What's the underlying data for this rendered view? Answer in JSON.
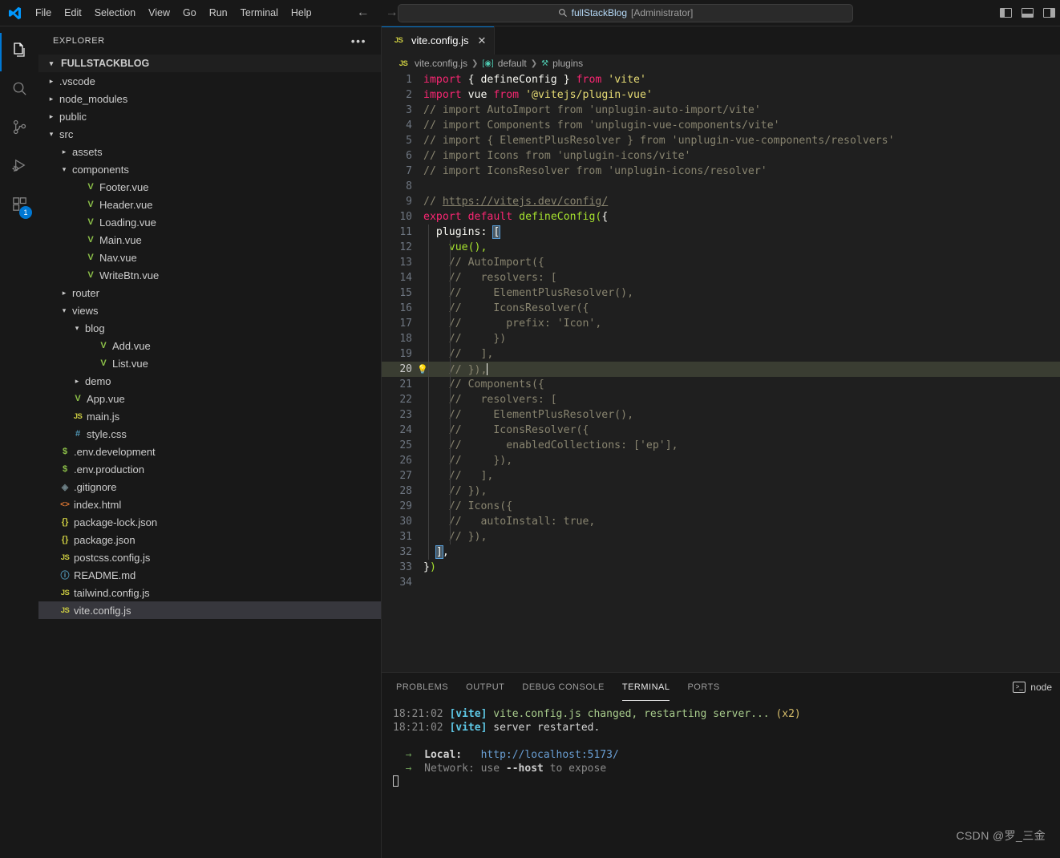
{
  "titlebar": {
    "logo_icon": "vscode-logo-icon",
    "menus": [
      "File",
      "Edit",
      "Selection",
      "View",
      "Go",
      "Run",
      "Terminal",
      "Help"
    ],
    "nav_back_icon": "arrow-left-icon",
    "nav_forward_icon": "arrow-right-icon",
    "search": {
      "icon": "search-icon",
      "project": "fullStackBlog",
      "suffix": "[Administrator]"
    },
    "layout_controls": [
      "toggle-primary-sidebar-icon",
      "toggle-panel-icon",
      "toggle-secondary-sidebar-icon"
    ]
  },
  "activitybar": {
    "items": [
      {
        "name": "explorer",
        "icon": "files-icon",
        "active": true,
        "badge": ""
      },
      {
        "name": "search",
        "icon": "search-icon",
        "active": false,
        "badge": ""
      },
      {
        "name": "source-control",
        "icon": "source-control-icon",
        "active": false,
        "badge": ""
      },
      {
        "name": "run-and-debug",
        "icon": "run-debug-icon",
        "active": false,
        "badge": ""
      },
      {
        "name": "extensions",
        "icon": "extensions-icon",
        "active": false,
        "badge": "1"
      }
    ]
  },
  "sidebar": {
    "title": "EXPLORER",
    "more_actions": "•••",
    "root": "FULLSTACKBLOG",
    "tree": [
      {
        "label": ".vscode",
        "indent": 1,
        "kind": "folder",
        "expanded": false,
        "icon": "chevron-right-icon"
      },
      {
        "label": "node_modules",
        "indent": 1,
        "kind": "folder",
        "expanded": false,
        "icon": "chevron-right-icon"
      },
      {
        "label": "public",
        "indent": 1,
        "kind": "folder",
        "expanded": false,
        "icon": "chevron-right-icon"
      },
      {
        "label": "src",
        "indent": 1,
        "kind": "folder",
        "expanded": true,
        "icon": "chevron-down-icon"
      },
      {
        "label": "assets",
        "indent": 2,
        "kind": "folder",
        "expanded": false,
        "icon": "chevron-right-icon"
      },
      {
        "label": "components",
        "indent": 2,
        "kind": "folder",
        "expanded": true,
        "icon": "chevron-down-icon"
      },
      {
        "label": "Footer.vue",
        "indent": 3,
        "kind": "file",
        "icon": "vue-file-icon",
        "glyph": "V",
        "cls": "i-vue"
      },
      {
        "label": "Header.vue",
        "indent": 3,
        "kind": "file",
        "icon": "vue-file-icon",
        "glyph": "V",
        "cls": "i-vue"
      },
      {
        "label": "Loading.vue",
        "indent": 3,
        "kind": "file",
        "icon": "vue-file-icon",
        "glyph": "V",
        "cls": "i-vue"
      },
      {
        "label": "Main.vue",
        "indent": 3,
        "kind": "file",
        "icon": "vue-file-icon",
        "glyph": "V",
        "cls": "i-vue"
      },
      {
        "label": "Nav.vue",
        "indent": 3,
        "kind": "file",
        "icon": "vue-file-icon",
        "glyph": "V",
        "cls": "i-vue"
      },
      {
        "label": "WriteBtn.vue",
        "indent": 3,
        "kind": "file",
        "icon": "vue-file-icon",
        "glyph": "V",
        "cls": "i-vue"
      },
      {
        "label": "router",
        "indent": 2,
        "kind": "folder",
        "expanded": false,
        "icon": "chevron-right-icon"
      },
      {
        "label": "views",
        "indent": 2,
        "kind": "folder",
        "expanded": true,
        "icon": "chevron-down-icon"
      },
      {
        "label": "blog",
        "indent": 3,
        "kind": "folder",
        "expanded": true,
        "icon": "chevron-down-icon"
      },
      {
        "label": "Add.vue",
        "indent": 4,
        "kind": "file",
        "icon": "vue-file-icon",
        "glyph": "V",
        "cls": "i-vue"
      },
      {
        "label": "List.vue",
        "indent": 4,
        "kind": "file",
        "icon": "vue-file-icon",
        "glyph": "V",
        "cls": "i-vue"
      },
      {
        "label": "demo",
        "indent": 3,
        "kind": "folder",
        "expanded": false,
        "icon": "chevron-right-icon"
      },
      {
        "label": "App.vue",
        "indent": 2,
        "kind": "file",
        "icon": "vue-file-icon",
        "glyph": "V",
        "cls": "i-vue"
      },
      {
        "label": "main.js",
        "indent": 2,
        "kind": "file",
        "icon": "js-file-icon",
        "glyph": "JS",
        "cls": "i-js"
      },
      {
        "label": "style.css",
        "indent": 2,
        "kind": "file",
        "icon": "css-file-icon",
        "glyph": "#",
        "cls": "i-css"
      },
      {
        "label": ".env.development",
        "indent": 1,
        "kind": "file",
        "icon": "env-file-icon",
        "glyph": "$",
        "cls": "i-env"
      },
      {
        "label": ".env.production",
        "indent": 1,
        "kind": "file",
        "icon": "env-file-icon",
        "glyph": "$",
        "cls": "i-env"
      },
      {
        "label": ".gitignore",
        "indent": 1,
        "kind": "file",
        "icon": "git-file-icon",
        "glyph": "◈",
        "cls": "i-git"
      },
      {
        "label": "index.html",
        "indent": 1,
        "kind": "file",
        "icon": "html-file-icon",
        "glyph": "<>",
        "cls": "i-html"
      },
      {
        "label": "package-lock.json",
        "indent": 1,
        "kind": "file",
        "icon": "json-file-icon",
        "glyph": "{}",
        "cls": "i-json"
      },
      {
        "label": "package.json",
        "indent": 1,
        "kind": "file",
        "icon": "json-file-icon",
        "glyph": "{}",
        "cls": "i-json"
      },
      {
        "label": "postcss.config.js",
        "indent": 1,
        "kind": "file",
        "icon": "js-file-icon",
        "glyph": "JS",
        "cls": "i-js"
      },
      {
        "label": "README.md",
        "indent": 1,
        "kind": "file",
        "icon": "markdown-file-icon",
        "glyph": "ⓘ",
        "cls": "i-md"
      },
      {
        "label": "tailwind.config.js",
        "indent": 1,
        "kind": "file",
        "icon": "js-file-icon",
        "glyph": "JS",
        "cls": "i-js"
      },
      {
        "label": "vite.config.js",
        "indent": 1,
        "kind": "file",
        "icon": "js-file-icon",
        "glyph": "JS",
        "cls": "i-js",
        "selected": true
      }
    ]
  },
  "editor": {
    "tab": {
      "icon": "js-file-icon",
      "glyph": "JS",
      "label": "vite.config.js",
      "close_icon": "close-icon"
    },
    "breadcrumbs": [
      {
        "icon": "js-file-icon",
        "glyph": "JS",
        "label": "vite.config.js"
      },
      {
        "icon": "symbol-variable-icon",
        "glyph": "[◉]",
        "label": "default"
      },
      {
        "icon": "symbol-property-icon",
        "glyph": "⚒",
        "label": "plugins"
      }
    ],
    "active_line": 20,
    "total_lines": 34,
    "lines": [
      {
        "n": 1,
        "tokens": [
          {
            "t": "import",
            "c": "t-kw"
          },
          {
            "t": " { ",
            "c": "t-pn"
          },
          {
            "t": "defineConfig",
            "c": "t-var"
          },
          {
            "t": " } ",
            "c": "t-pn"
          },
          {
            "t": "from",
            "c": "t-kw"
          },
          {
            "t": " ",
            "c": "t-pn"
          },
          {
            "t": "'vite'",
            "c": "t-str"
          }
        ]
      },
      {
        "n": 2,
        "tokens": [
          {
            "t": "import",
            "c": "t-kw"
          },
          {
            "t": " vue ",
            "c": "t-var"
          },
          {
            "t": "from",
            "c": "t-kw"
          },
          {
            "t": " ",
            "c": "t-pn"
          },
          {
            "t": "'@vitejs/plugin-vue'",
            "c": "t-str"
          }
        ]
      },
      {
        "n": 3,
        "tokens": [
          {
            "t": "// import AutoImport from 'unplugin-auto-import/vite'",
            "c": "t-cm"
          }
        ]
      },
      {
        "n": 4,
        "tokens": [
          {
            "t": "// import Components from 'unplugin-vue-components/vite'",
            "c": "t-cm"
          }
        ]
      },
      {
        "n": 5,
        "tokens": [
          {
            "t": "// import { ElementPlusResolver } from 'unplugin-vue-components/resolvers'",
            "c": "t-cm"
          }
        ]
      },
      {
        "n": 6,
        "tokens": [
          {
            "t": "// import Icons from 'unplugin-icons/vite'",
            "c": "t-cm"
          }
        ]
      },
      {
        "n": 7,
        "tokens": [
          {
            "t": "// import IconsResolver from 'unplugin-icons/resolver'",
            "c": "t-cm"
          }
        ]
      },
      {
        "n": 8,
        "tokens": []
      },
      {
        "n": 9,
        "tokens": [
          {
            "t": "// ",
            "c": "t-cm"
          },
          {
            "t": "https://vitejs.dev/config/",
            "c": "t-cm-link"
          }
        ]
      },
      {
        "n": 10,
        "tokens": [
          {
            "t": "export",
            "c": "t-kw"
          },
          {
            "t": " ",
            "c": "t-pn"
          },
          {
            "t": "default",
            "c": "t-kw"
          },
          {
            "t": " ",
            "c": "t-pn"
          },
          {
            "t": "defineConfig",
            "c": "t-fn"
          },
          {
            "t": "(",
            "c": "t-par"
          },
          {
            "t": "{",
            "c": "t-pn"
          }
        ]
      },
      {
        "n": 11,
        "tokens": [
          {
            "t": "  plugins",
            "c": "t-var"
          },
          {
            "t": ": ",
            "c": "t-pn"
          },
          {
            "t": "[",
            "c": "t-brk-hl"
          }
        ]
      },
      {
        "n": 12,
        "tokens": [
          {
            "t": "    ",
            "c": "t-pn"
          },
          {
            "t": "vue",
            "c": "t-fn"
          },
          {
            "t": "(),",
            "c": "t-par"
          }
        ]
      },
      {
        "n": 13,
        "tokens": [
          {
            "t": "    // AutoImport({",
            "c": "t-cm"
          }
        ]
      },
      {
        "n": 14,
        "tokens": [
          {
            "t": "    //   resolvers: [",
            "c": "t-cm"
          }
        ]
      },
      {
        "n": 15,
        "tokens": [
          {
            "t": "    //     ElementPlusResolver(),",
            "c": "t-cm"
          }
        ]
      },
      {
        "n": 16,
        "tokens": [
          {
            "t": "    //     IconsResolver({",
            "c": "t-cm"
          }
        ]
      },
      {
        "n": 17,
        "tokens": [
          {
            "t": "    //       prefix: 'Icon',",
            "c": "t-cm"
          }
        ]
      },
      {
        "n": 18,
        "tokens": [
          {
            "t": "    //     })",
            "c": "t-cm"
          }
        ]
      },
      {
        "n": 19,
        "tokens": [
          {
            "t": "    //   ],",
            "c": "t-cm"
          }
        ]
      },
      {
        "n": 20,
        "tokens": [
          {
            "t": "    // }),",
            "c": "t-cm"
          }
        ],
        "bulb": "lightbulb-icon",
        "caret": true
      },
      {
        "n": 21,
        "tokens": [
          {
            "t": "    // Components({",
            "c": "t-cm"
          }
        ]
      },
      {
        "n": 22,
        "tokens": [
          {
            "t": "    //   resolvers: [",
            "c": "t-cm"
          }
        ]
      },
      {
        "n": 23,
        "tokens": [
          {
            "t": "    //     ElementPlusResolver(),",
            "c": "t-cm"
          }
        ]
      },
      {
        "n": 24,
        "tokens": [
          {
            "t": "    //     IconsResolver({",
            "c": "t-cm"
          }
        ]
      },
      {
        "n": 25,
        "tokens": [
          {
            "t": "    //       enabledCollections: ['ep'],",
            "c": "t-cm"
          }
        ]
      },
      {
        "n": 26,
        "tokens": [
          {
            "t": "    //     }),",
            "c": "t-cm"
          }
        ]
      },
      {
        "n": 27,
        "tokens": [
          {
            "t": "    //   ],",
            "c": "t-cm"
          }
        ]
      },
      {
        "n": 28,
        "tokens": [
          {
            "t": "    // }),",
            "c": "t-cm"
          }
        ]
      },
      {
        "n": 29,
        "tokens": [
          {
            "t": "    // Icons({",
            "c": "t-cm"
          }
        ]
      },
      {
        "n": 30,
        "tokens": [
          {
            "t": "    //   autoInstall: true,",
            "c": "t-cm"
          }
        ]
      },
      {
        "n": 31,
        "tokens": [
          {
            "t": "    // }),",
            "c": "t-cm"
          }
        ]
      },
      {
        "n": 32,
        "tokens": [
          {
            "t": "  ",
            "c": "t-pn"
          },
          {
            "t": "]",
            "c": "t-brk-hl"
          },
          {
            "t": ",",
            "c": "t-pn"
          }
        ]
      },
      {
        "n": 33,
        "tokens": [
          {
            "t": "}",
            "c": "t-pn"
          },
          {
            "t": ")",
            "c": "t-par"
          }
        ]
      },
      {
        "n": 34,
        "tokens": []
      }
    ]
  },
  "panel": {
    "tabs": [
      {
        "label": "PROBLEMS",
        "active": false
      },
      {
        "label": "OUTPUT",
        "active": false
      },
      {
        "label": "DEBUG CONSOLE",
        "active": false
      },
      {
        "label": "TERMINAL",
        "active": true
      },
      {
        "label": "PORTS",
        "active": false
      }
    ],
    "terminal_name": "node",
    "terminal_icon": "terminal-icon",
    "terminal_lines": [
      [
        {
          "t": "18:21:02 ",
          "c": "tm-time"
        },
        {
          "t": "[vite]",
          "c": "tm-vite"
        },
        {
          "t": " vite.config.js changed, restarting server... ",
          "c": "tm-txt"
        },
        {
          "t": "(x2)",
          "c": "tm-x2"
        }
      ],
      [
        {
          "t": "18:21:02 ",
          "c": "tm-time"
        },
        {
          "t": "[vite]",
          "c": "tm-vite"
        },
        {
          "t": " server restarted.",
          "c": "tm-plain"
        }
      ],
      [],
      [
        {
          "t": "  →  ",
          "c": "tm-arrow"
        },
        {
          "t": "Local:",
          "c": "tm-label"
        },
        {
          "t": "   ",
          "c": "tm-plain"
        },
        {
          "t": "http://localhost:5173/",
          "c": "tm-url"
        }
      ],
      [
        {
          "t": "  →  ",
          "c": "tm-arrow"
        },
        {
          "t": "Network",
          "c": "tm-dim"
        },
        {
          "t": ": use ",
          "c": "tm-dim"
        },
        {
          "t": "--host",
          "c": "tm-host"
        },
        {
          "t": " to expose",
          "c": "tm-dim"
        }
      ]
    ],
    "cursor_glyph": "block-cursor-icon"
  },
  "watermark": "CSDN @罗_三金",
  "colors": {
    "accent": "#0078d4",
    "titlebar_bg": "#181818",
    "editor_bg": "#1f1f1f",
    "active_line_bg": "#3a3d32",
    "selection_bg": "#37373d",
    "vue_green": "#8dc149",
    "js_yellow": "#cbcb41"
  }
}
